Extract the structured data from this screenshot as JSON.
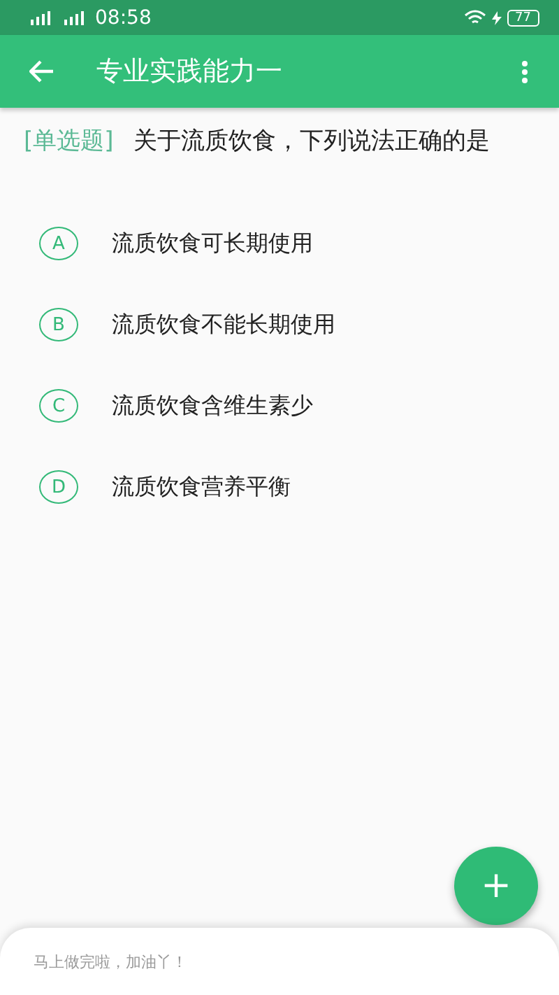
{
  "status_bar": {
    "time": "08:58",
    "battery": "77"
  },
  "app_bar": {
    "title": "专业实践能力一"
  },
  "question": {
    "type_label": "[单选题]",
    "text": "关于流质饮食，下列说法正确的是"
  },
  "options": [
    {
      "letter": "A",
      "text": "流质饮食可长期使用",
      "selected": false
    },
    {
      "letter": "B",
      "text": "流质饮食不能长期使用",
      "selected": false
    },
    {
      "letter": "C",
      "text": "流质饮食含维生素少",
      "selected": false
    },
    {
      "letter": "D",
      "text": "流质饮食营养平衡",
      "selected": false
    }
  ],
  "fab": {
    "label": "+"
  },
  "bottom_sheet": {
    "message": "马上做完啦，加油丫！"
  }
}
